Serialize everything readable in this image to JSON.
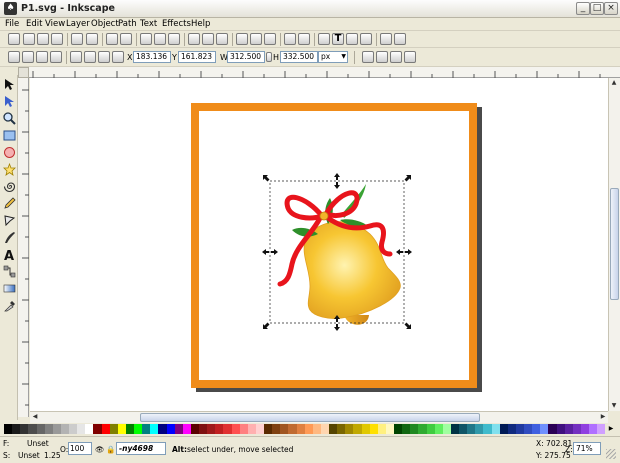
{
  "window": {
    "title": "P1.svg - Inkscape"
  },
  "menu": [
    "File",
    "Edit",
    "View",
    "Layer",
    "Object",
    "Path",
    "Text",
    "Effects",
    "Help"
  ],
  "select_toolbar": {
    "x_label": "X",
    "x_value": "183.136",
    "y_label": "Y",
    "y_value": "161.823",
    "w_label": "W",
    "w_value": "312.500",
    "h_label": "H",
    "h_value": "332.500",
    "unit": "px"
  },
  "status": {
    "fill_label": "F:",
    "fill_value": "Unset",
    "stroke_label": "S:",
    "stroke_value": "Unset",
    "stroke_width": "1.25",
    "opacity_label": "O:",
    "opacity_value": "100",
    "layer_value": "-ny4698",
    "message_bold": "Alt:",
    "message": "select under, move selected",
    "x_coord": "X: 702.81",
    "y_coord": "Y: 275.75",
    "zoom_label": "Z:",
    "zoom_value": "71%"
  },
  "colors": {
    "frame": "#f08c1a",
    "bell": "#f7c632",
    "ribbon": "#e8141c",
    "holly": "#2e8f2a",
    "chrome": "#ece9d8"
  },
  "palette": [
    "#000000",
    "#1a1a1a",
    "#333333",
    "#4d4d4d",
    "#666666",
    "#808080",
    "#999999",
    "#b3b3b3",
    "#cccccc",
    "#e6e6e6",
    "#ffffff",
    "#800000",
    "#ff0000",
    "#808000",
    "#ffff00",
    "#008000",
    "#00ff00",
    "#008080",
    "#00ffff",
    "#000080",
    "#0000ff",
    "#800080",
    "#ff00ff",
    "#5a0000",
    "#7f1010",
    "#a01a1a",
    "#c02020",
    "#e03030",
    "#ff5050",
    "#ff8080",
    "#ffb0b0",
    "#ffd0d0",
    "#5a2a00",
    "#7f4010",
    "#a05520",
    "#c06a30",
    "#e08040",
    "#ff9a55",
    "#ffb880",
    "#ffd6b0",
    "#554400",
    "#7a6600",
    "#a08800",
    "#c0a800",
    "#e0c800",
    "#ffe000",
    "#fff080",
    "#fff8c0",
    "#004400",
    "#106610",
    "#208820",
    "#30aa30",
    "#40cc40",
    "#60ee60",
    "#a0ffa0",
    "#003344",
    "#105566",
    "#207788",
    "#3099aa",
    "#40bbcc",
    "#80e0ee",
    "#001a55",
    "#102a7f",
    "#203aa0",
    "#304cc0",
    "#4060e0",
    "#7090ff",
    "#2a0055",
    "#40107f",
    "#5a20a0",
    "#7430c0",
    "#9040e0",
    "#b070ff",
    "#d0a0ff"
  ]
}
